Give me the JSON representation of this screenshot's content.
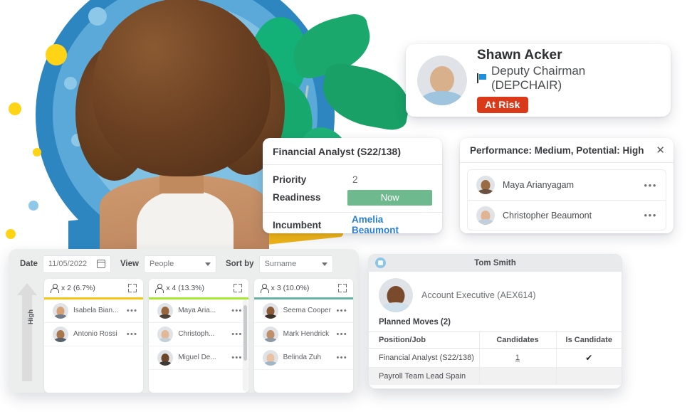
{
  "theme": {
    "accent_blue": "#2d86c0",
    "accent_yellow": "#ffd417",
    "accent_green": "#1aa86c",
    "risk_red": "#d93a1a",
    "readiness_green": "#6fb98f",
    "link_blue": "#2a7fd4",
    "col_accents": [
      "#f5c518",
      "#a6e832",
      "#66b3a6"
    ]
  },
  "shawn_card": {
    "name": "Shawn Acker",
    "role": "Deputy Chairman (DEPCHAIR)",
    "flag_icon": "flag-icon",
    "badge": "At Risk"
  },
  "financial_analyst_card": {
    "title": "Financial Analyst (S22/138)",
    "rows": [
      {
        "label": "Priority",
        "value": "2"
      },
      {
        "label": "Readiness",
        "value": "Now"
      }
    ],
    "incumbent_label": "Incumbent",
    "incumbent_name": "Amelia Beaumont"
  },
  "performance_card": {
    "title": "Performance: Medium, Potential: High",
    "close_icon": "close-icon",
    "people": [
      {
        "name": "Maya Arianyagam",
        "menu": "•••"
      },
      {
        "name": "Christopher Beaumont",
        "menu": "•••"
      }
    ]
  },
  "matrix_panel": {
    "toolbar": {
      "date_label": "Date",
      "date_value": "11/05/2022",
      "date_icon": "calendar-icon",
      "view_label": "View",
      "view_value": "People",
      "sort_label": "Sort by",
      "sort_value": "Surname"
    },
    "axis_label": "High",
    "axis_icon": "up-arrow-icon",
    "columns": [
      {
        "count_text": "x 2 (6.7%)",
        "accent": "#f5c518",
        "people": [
          {
            "name": "Isabela Bian...",
            "menu": "•••"
          },
          {
            "name": "Antonio Rossi",
            "menu": "•••"
          }
        ]
      },
      {
        "count_text": "x 4 (13.3%)",
        "accent": "#a6e832",
        "people": [
          {
            "name": "Maya Aria...",
            "menu": "•••"
          },
          {
            "name": "Christoph...",
            "menu": "•••"
          },
          {
            "name": "Miguel De...",
            "menu": "•••"
          }
        ]
      },
      {
        "count_text": "x 3 (10.0%)",
        "accent": "#66b3a6",
        "people": [
          {
            "name": "Seema Cooper",
            "menu": "•••"
          },
          {
            "name": "Mark Hendrick",
            "menu": "•••"
          },
          {
            "name": "Belinda Zuh",
            "menu": "•••"
          }
        ]
      }
    ]
  },
  "tom_panel": {
    "window_title": "Tom Smith",
    "gear_icon": "gear-icon",
    "role": "Account Executive (AEX614)",
    "section_title": "Planned Moves (2)",
    "table": {
      "headers": [
        "Position/Job",
        "Candidates",
        "Is Candidate"
      ],
      "rows": [
        {
          "position": "Financial Analyst (S22/138)",
          "candidates": "1",
          "is_candidate": "✔"
        },
        {
          "position": "Payroll Team Lead Spain",
          "candidates": "",
          "is_candidate": ""
        }
      ]
    }
  }
}
